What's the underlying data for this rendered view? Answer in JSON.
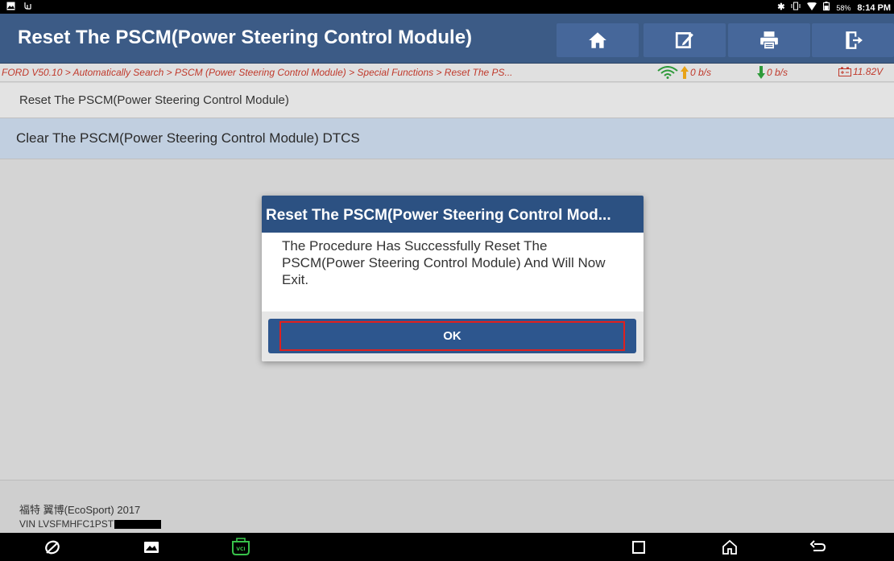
{
  "status_bar": {
    "battery_percent": "58%",
    "time": "8:14 PM"
  },
  "header": {
    "title": "Reset The PSCM(Power Steering Control Module)",
    "buttons": [
      "home-icon",
      "edit-icon",
      "print-icon",
      "exit-icon"
    ]
  },
  "breadcrumb": {
    "path": "FORD V50.10 > Automatically Search > PSCM (Power Steering Control Module) > Special Functions > Reset The PS...",
    "upload_rate": "0 b/s",
    "download_rate": "0 b/s",
    "voltage": "11.82V"
  },
  "menu": {
    "items": [
      "Reset The PSCM(Power Steering Control Module)",
      "Clear The PSCM(Power Steering Control Module) DTCS"
    ]
  },
  "footer": {
    "vehicle": "福特 翼博(EcoSport) 2017",
    "vin_prefix": "VIN LVSFMHFC1PST"
  },
  "dialog": {
    "title": "Reset The PSCM(Power Steering Control Mod...",
    "message": "The Procedure Has Successfully Reset The PSCM(Power Steering Control Module) And Will Now Exit.",
    "ok_label": "OK"
  },
  "colors": {
    "header_bg": "#3c5b86",
    "dialog_header_bg": "#2c5182",
    "breadcrumb_text": "#c0392b",
    "highlight_border": "#e0201e",
    "download_arrow": "#2e9a3a",
    "upload_arrow": "#e8a317"
  }
}
